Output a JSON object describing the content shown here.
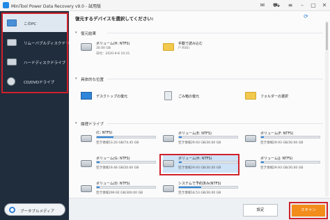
{
  "window": {
    "title": "MiniTool Power Data Recovery v9.0 - 試用版"
  },
  "sidebar": {
    "items": [
      {
        "label": "このPC"
      },
      {
        "label": "リムーバブルディスクドライブ"
      },
      {
        "label": "ハードディスクドライブ"
      },
      {
        "label": "CD/DVDドライブ"
      }
    ],
    "portable_media_label": "ブータブルメディア"
  },
  "main": {
    "heading": "復元するデバイスを選択してください:",
    "recent": {
      "title": "復元結果",
      "volume": {
        "name": "ボリューム(H: NTFS)",
        "size": "30.00 GB",
        "date": "日付：2020-9-8 10:31"
      },
      "manual_load": {
        "name": "手動で読み込む",
        "sub": "(*.RSS)"
      }
    },
    "locations": {
      "title": "具体的な位置",
      "items": [
        {
          "label": "デスクトップの復元"
        },
        {
          "label": "ごみ箱の復元"
        },
        {
          "label": "フォルダーの選択"
        }
      ]
    },
    "logical": {
      "title": "論理ドライブ",
      "volumes": [
        {
          "name": "(C: NTFS)",
          "space": "空き領域53.20 GB/74.45 GB",
          "used": 0.29
        },
        {
          "name": "ボリューム(E: NTFS)",
          "space": "空き領域29.93 GB/30.00 GB",
          "used": 0.05
        },
        {
          "name": "ボリューム(F: NTFS)",
          "space": "空き領域29.93 GB/30.00 GB",
          "used": 0.05
        },
        {
          "name": "ボリューム(G: NTFS)",
          "space": "空き領域19.46 GB/20.00 GB",
          "used": 0.05
        },
        {
          "name": "ボリューム(H: NTFS)",
          "space": "空き領域29.93 GB/30.00 GB",
          "used": 0.05
        },
        {
          "name": "ボリューム(J: NTFS)",
          "space": "空き領域29.93 GB/30.00 GB",
          "used": 0.05
        },
        {
          "name": "ボリューム(D: NTFS)",
          "space": "空き領域299.92 GB/300.00 GB",
          "used": 0.05
        },
        {
          "name": "システムで予約済み(NTFS)",
          "space": "空き領域18.53 GB/30.00 GB",
          "used": 0.38
        }
      ]
    }
  },
  "footer": {
    "settings_label": "設定",
    "scan_label": "スキャン"
  },
  "colors": {
    "accent": "#2f86d9",
    "scan": "#f28c1b",
    "highlight": "#d0202a",
    "sidebar": "#1f2d3d"
  }
}
